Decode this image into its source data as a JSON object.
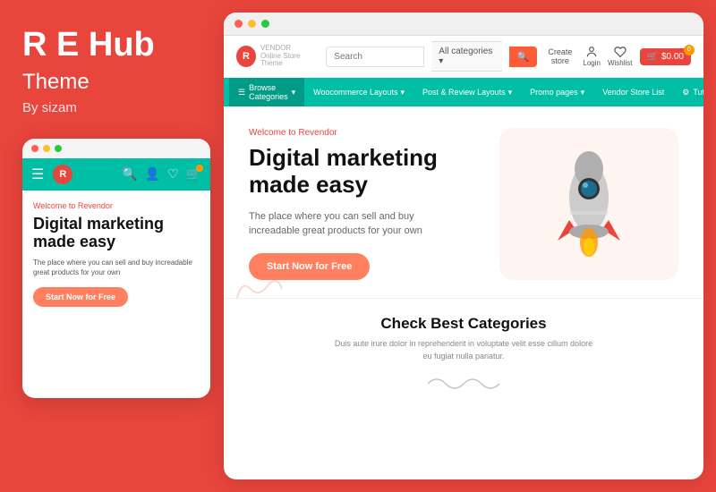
{
  "left": {
    "title": "R E Hub",
    "subtitle": "Theme",
    "author": "By sizam",
    "mobile": {
      "welcome": "Welcome to Revendor",
      "hero_title": "Digital marketing made easy",
      "hero_sub": "The place where you can sell and buy increadable great products for your own",
      "cta": "Start Now for Free"
    }
  },
  "right": {
    "browser_dots": [
      "red",
      "yellow",
      "green"
    ],
    "header": {
      "logo_letter": "R",
      "logo_name": "VENDOR",
      "logo_tagline": "Online Store Theme",
      "search_placeholder": "Search",
      "search_category": "All categories",
      "create_store": "Create store",
      "login": "Login",
      "wishlist": "Wishlist",
      "cart_price": "$0.00",
      "cart_badge": "0"
    },
    "menu": {
      "browse": "Browse Categories",
      "items": [
        "Woocommerce Layouts",
        "Post & Review Layouts",
        "Promo pages",
        "Vendor Store List",
        "Tutorials"
      ]
    },
    "hero": {
      "welcome": "Welcome to Revendor",
      "title": "Digital marketing made easy",
      "sub": "The place where you can sell and buy increadable great products for your own",
      "cta": "Start Now for Free"
    },
    "categories": {
      "title": "Check Best Categories",
      "sub": "Duis aute irure dolor in reprehenderit in voluptate velit esse cillum dolore eu fugiat nulla pariatur."
    }
  }
}
